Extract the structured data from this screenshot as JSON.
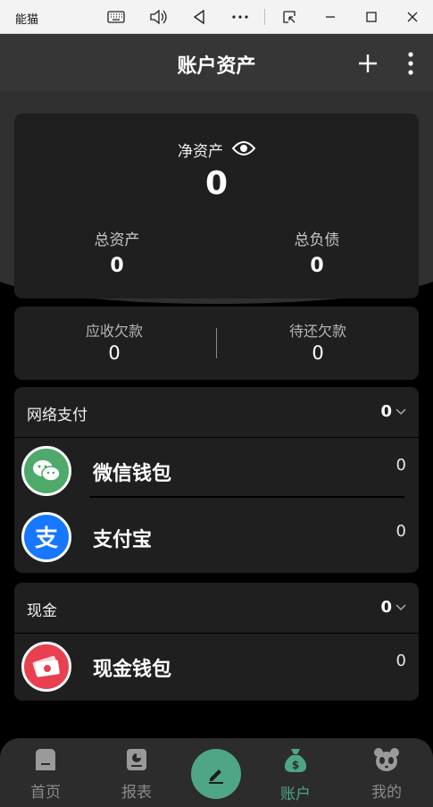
{
  "emulator": {
    "title": "能猫"
  },
  "header": {
    "title": "账户资产"
  },
  "summary": {
    "net_label": "净资产",
    "net_value": "0",
    "total_assets_label": "总资产",
    "total_assets_value": "0",
    "total_liabilities_label": "总负债",
    "total_liabilities_value": "0"
  },
  "debts": {
    "receivable_label": "应收欠款",
    "receivable_value": "0",
    "payable_label": "待还欠款",
    "payable_value": "0"
  },
  "groups": [
    {
      "title": "网络支付",
      "total": "0",
      "accounts": [
        {
          "name": "微信钱包",
          "value": "0",
          "icon": "wechat-icon",
          "color": "#4ea96b"
        },
        {
          "name": "支付宝",
          "value": "0",
          "icon": "alipay-icon",
          "color": "#1677ff"
        }
      ]
    },
    {
      "title": "现金",
      "total": "0",
      "accounts": [
        {
          "name": "现金钱包",
          "value": "0",
          "icon": "cash-icon",
          "color": "#e8404f"
        }
      ]
    }
  ],
  "nav": {
    "home": "首页",
    "reports": "报表",
    "accounts": "账户",
    "mine": "我的",
    "active_color": "#4ea684"
  }
}
